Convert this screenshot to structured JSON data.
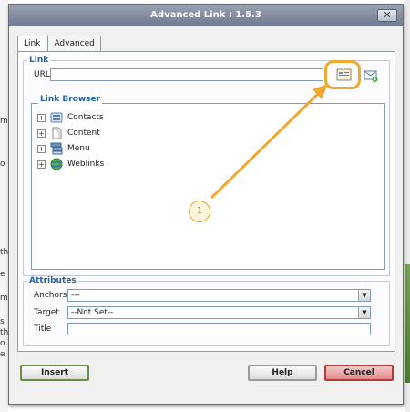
{
  "background": {
    "left_fragments": [
      "ma",
      "o",
      "th",
      "e",
      "me",
      "s",
      "th",
      "o",
      "e"
    ]
  },
  "dialog": {
    "title": "Advanced Link : 1.5.3",
    "close_glyph": "✕"
  },
  "tabs": [
    {
      "label": "Link",
      "active": true
    },
    {
      "label": "Advanced",
      "active": false
    }
  ],
  "link_section": {
    "legend": "Link",
    "url_label": "URL",
    "url_value": "",
    "browser_legend": "Link Browser",
    "tree": [
      {
        "label": "Contacts",
        "icon": "contacts-icon"
      },
      {
        "label": "Content",
        "icon": "content-icon"
      },
      {
        "label": "Menu",
        "icon": "menu-icon"
      },
      {
        "label": "Weblinks",
        "icon": "weblinks-icon"
      }
    ]
  },
  "attributes": {
    "legend": "Attributes",
    "anchors_label": "Anchors",
    "anchors_value": "---",
    "target_label": "Target",
    "target_value": "--Not Set--",
    "title_label": "Title",
    "title_value": ""
  },
  "buttons": {
    "insert": "Insert",
    "help": "Help",
    "cancel": "Cancel"
  },
  "annotation": {
    "callout_number": "1",
    "color": "#f0a830"
  }
}
